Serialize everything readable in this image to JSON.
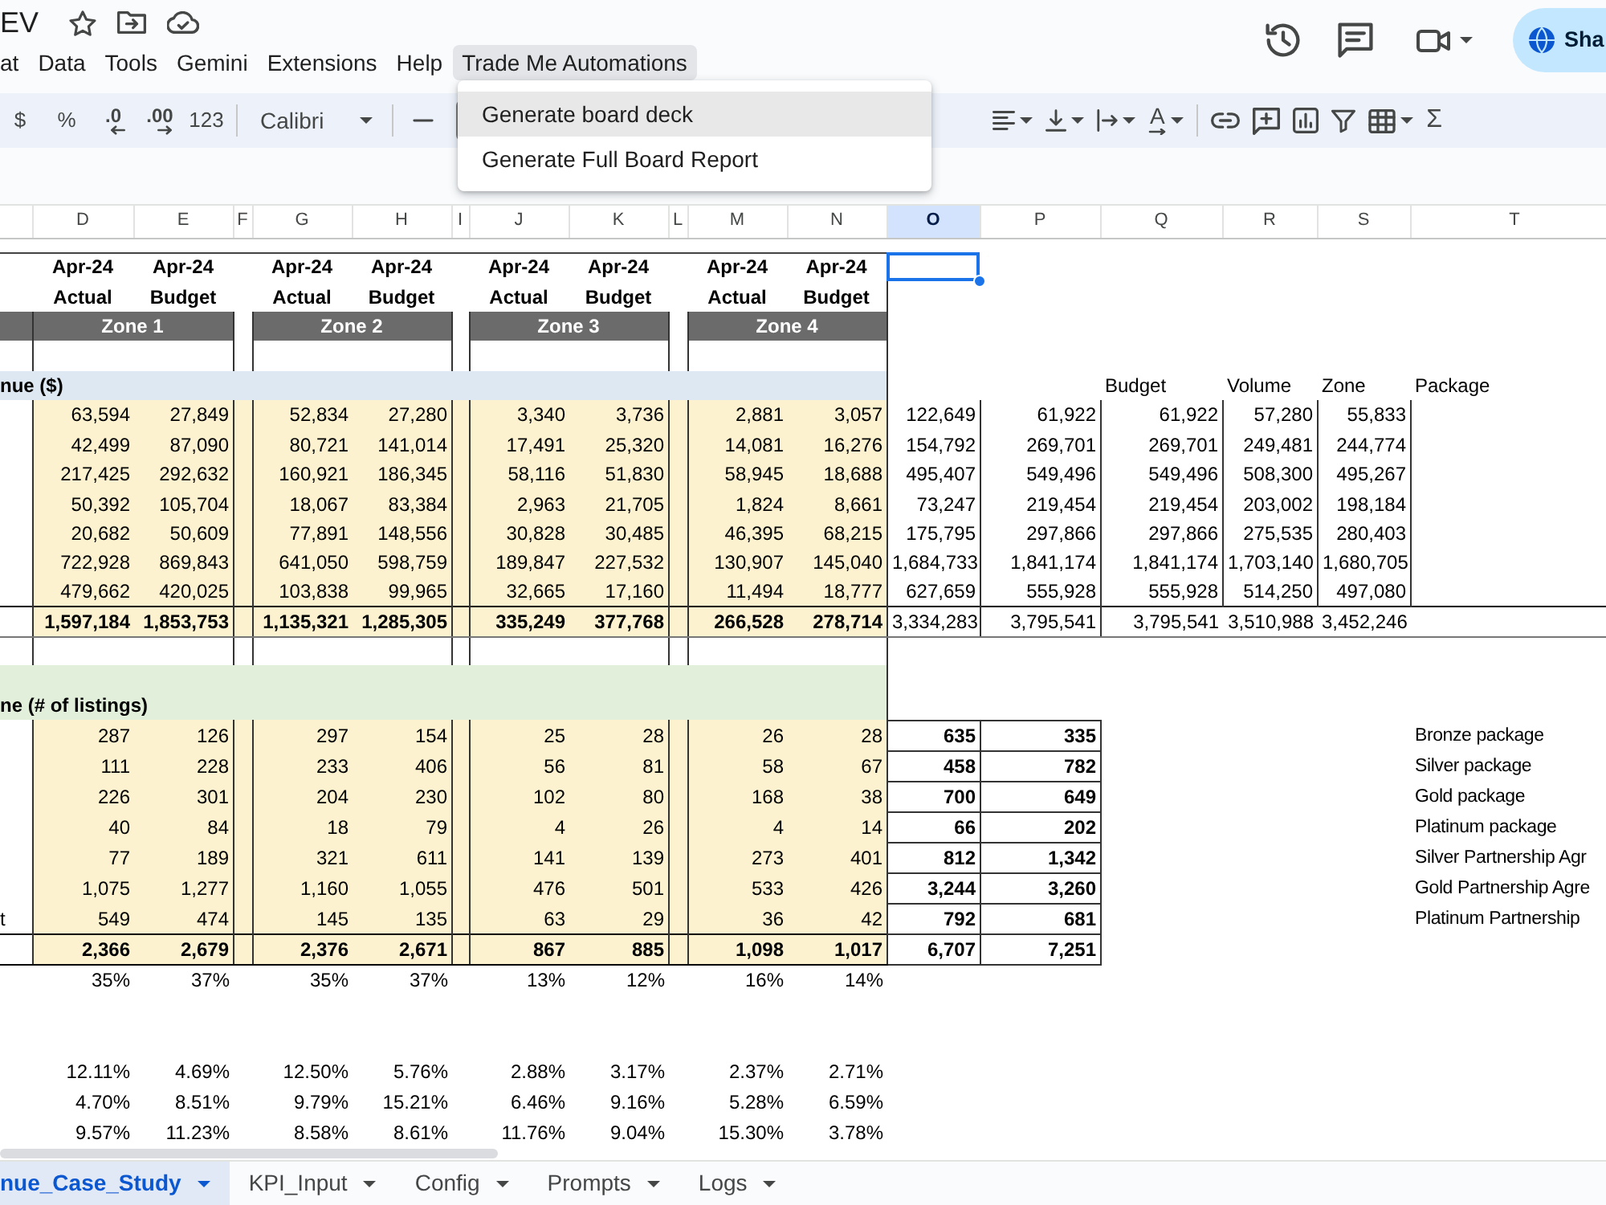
{
  "document": {
    "title": "EV"
  },
  "menu_bar": [
    {
      "label": "at",
      "selected": false
    },
    {
      "label": "Data",
      "selected": false
    },
    {
      "label": "Tools",
      "selected": false
    },
    {
      "label": "Gemini",
      "selected": false
    },
    {
      "label": "Extensions",
      "selected": false
    },
    {
      "label": "Help",
      "selected": false
    },
    {
      "label": "Trade Me Automations",
      "selected": true
    }
  ],
  "open_menu": [
    {
      "label": "Generate board deck",
      "selected": true
    },
    {
      "label": "Generate Full Board Report",
      "selected": false
    }
  ],
  "share_button": {
    "label": "Sha"
  },
  "toolbar_left": [
    {
      "kind": "text",
      "label": "$"
    },
    {
      "kind": "text",
      "label": "%"
    },
    {
      "kind": "decrease-decimal",
      "label": ".0"
    },
    {
      "kind": "increase-decimal",
      "label": ".00"
    },
    {
      "kind": "text",
      "label": "123"
    },
    {
      "kind": "divider"
    },
    {
      "kind": "font",
      "label": "Calibri"
    },
    {
      "kind": "divider"
    },
    {
      "kind": "minus"
    },
    {
      "kind": "size-field"
    }
  ],
  "toolbar_right": [
    {
      "kind": "align"
    },
    {
      "kind": "valign"
    },
    {
      "kind": "wrap"
    },
    {
      "kind": "rotate",
      "label": "A"
    },
    {
      "kind": "divider"
    },
    {
      "kind": "link"
    },
    {
      "kind": "comment"
    },
    {
      "kind": "chart"
    },
    {
      "kind": "filter"
    },
    {
      "kind": "table"
    },
    {
      "kind": "glyph",
      "label": "Σ"
    }
  ],
  "sheet": {
    "column_headers": [
      {
        "label": "D",
        "selected": false
      },
      {
        "label": "E",
        "selected": false
      },
      {
        "label": "F",
        "selected": false
      },
      {
        "label": "G",
        "selected": false
      },
      {
        "label": "H",
        "selected": false
      },
      {
        "label": "I",
        "selected": false
      },
      {
        "label": "J",
        "selected": false
      },
      {
        "label": "K",
        "selected": false
      },
      {
        "label": "L",
        "selected": false
      },
      {
        "label": "M",
        "selected": false
      },
      {
        "label": "N",
        "selected": false
      },
      {
        "label": "O",
        "selected": true
      },
      {
        "label": "P",
        "selected": false
      },
      {
        "label": "Q",
        "selected": false
      },
      {
        "label": "R",
        "selected": false
      },
      {
        "label": "S",
        "selected": false
      },
      {
        "label": "T",
        "selected": false
      }
    ],
    "period_row": [
      "Apr-24",
      "Apr-24",
      "Apr-24",
      "Apr-24",
      "Apr-24",
      "Apr-24",
      "Apr-24",
      "Apr-24"
    ],
    "measure_row": [
      "Actual",
      "Budget",
      "Actual",
      "Budget",
      "Actual",
      "Budget",
      "Actual",
      "Budget"
    ],
    "zones": [
      "Zone 1",
      "Zone 2",
      "Zone 3",
      "Zone 4"
    ],
    "revenue": {
      "label": "nue ($)",
      "side_headers": [
        "Budget",
        "Volume",
        "Zone",
        "Package"
      ],
      "rows": [
        {
          "zone_values": [
            "63,594",
            "27,849",
            "52,834",
            "27,280",
            "3,340",
            "3,736",
            "2,881",
            "3,057"
          ],
          "side_values": [
            "122,649",
            "61,922",
            "61,922",
            "57,280",
            "55,833"
          ]
        },
        {
          "zone_values": [
            "42,499",
            "87,090",
            "80,721",
            "141,014",
            "17,491",
            "25,320",
            "14,081",
            "16,276"
          ],
          "side_values": [
            "154,792",
            "269,701",
            "269,701",
            "249,481",
            "244,774"
          ]
        },
        {
          "zone_values": [
            "217,425",
            "292,632",
            "160,921",
            "186,345",
            "58,116",
            "51,830",
            "58,945",
            "18,688"
          ],
          "side_values": [
            "495,407",
            "549,496",
            "549,496",
            "508,300",
            "495,267"
          ]
        },
        {
          "zone_values": [
            "50,392",
            "105,704",
            "18,067",
            "83,384",
            "2,963",
            "21,705",
            "1,824",
            "8,661"
          ],
          "side_values": [
            "73,247",
            "219,454",
            "219,454",
            "203,002",
            "198,184"
          ]
        },
        {
          "zone_values": [
            "20,682",
            "50,609",
            "77,891",
            "148,556",
            "30,828",
            "30,485",
            "46,395",
            "68,215"
          ],
          "side_values": [
            "175,795",
            "297,866",
            "297,866",
            "275,535",
            "280,403"
          ]
        },
        {
          "zone_values": [
            "722,928",
            "869,843",
            "641,050",
            "598,759",
            "189,847",
            "227,532",
            "130,907",
            "145,040"
          ],
          "side_values": [
            "1,684,733",
            "1,841,174",
            "1,841,174",
            "1,703,140",
            "1,680,705"
          ]
        },
        {
          "zone_values": [
            "479,662",
            "420,025",
            "103,838",
            "99,965",
            "32,665",
            "17,160",
            "11,494",
            "18,777"
          ],
          "side_values": [
            "627,659",
            "555,928",
            "555,928",
            "514,250",
            "497,080"
          ]
        }
      ],
      "total": {
        "zone_values": [
          "1,597,184",
          "1,853,753",
          "1,135,321",
          "1,285,305",
          "335,249",
          "377,768",
          "266,528",
          "278,714"
        ],
        "side_values": [
          "3,334,283",
          "3,795,541",
          "3,795,541",
          "3,510,988",
          "3,452,246"
        ]
      }
    },
    "volume": {
      "label": "ne (# of listings)",
      "rows": [
        {
          "zone_values": [
            "287",
            "126",
            "297",
            "154",
            "25",
            "28",
            "26",
            "28"
          ],
          "side_values": [
            "635",
            "335"
          ],
          "package": "Bronze package"
        },
        {
          "zone_values": [
            "111",
            "228",
            "233",
            "406",
            "56",
            "81",
            "58",
            "67"
          ],
          "side_values": [
            "458",
            "782"
          ],
          "package": "Silver package"
        },
        {
          "zone_values": [
            "226",
            "301",
            "204",
            "230",
            "102",
            "80",
            "168",
            "38"
          ],
          "side_values": [
            "700",
            "649"
          ],
          "package": "Gold package"
        },
        {
          "zone_values": [
            "40",
            "84",
            "18",
            "79",
            "4",
            "26",
            "4",
            "14"
          ],
          "side_values": [
            "66",
            "202"
          ],
          "package": "Platinum package"
        },
        {
          "zone_values": [
            "77",
            "189",
            "321",
            "611",
            "141",
            "139",
            "273",
            "401"
          ],
          "side_values": [
            "812",
            "1,342"
          ],
          "package": "Silver Partnership Agr"
        },
        {
          "zone_values": [
            "1,075",
            "1,277",
            "1,160",
            "1,055",
            "476",
            "501",
            "533",
            "426"
          ],
          "side_values": [
            "3,244",
            "3,260"
          ],
          "package": "Gold Partnership Agre"
        },
        {
          "label": "t",
          "zone_values": [
            "549",
            "474",
            "145",
            "135",
            "63",
            "29",
            "36",
            "42"
          ],
          "side_values": [
            "792",
            "681"
          ],
          "package": "Platinum Partnership"
        }
      ],
      "total": {
        "zone_values": [
          "2,366",
          "2,679",
          "2,376",
          "2,671",
          "867",
          "885",
          "1,098",
          "1,017"
        ],
        "side_values": [
          "6,707",
          "7,251"
        ]
      },
      "share": [
        "35%",
        "37%",
        "35%",
        "37%",
        "13%",
        "12%",
        "16%",
        "14%"
      ]
    },
    "ratios": [
      [
        "12.11%",
        "4.69%",
        "12.50%",
        "5.76%",
        "2.88%",
        "3.17%",
        "2.37%",
        "2.71%"
      ],
      [
        "4.70%",
        "8.51%",
        "9.79%",
        "15.21%",
        "6.46%",
        "9.16%",
        "5.28%",
        "6.59%"
      ],
      [
        "9.57%",
        "11.23%",
        "8.58%",
        "8.61%",
        "11.76%",
        "9.04%",
        "15.30%",
        "3.78%"
      ]
    ]
  },
  "sheet_tabs": [
    {
      "label": "nue_Case_Study",
      "selected": true
    },
    {
      "label": "KPI_Input",
      "selected": false
    },
    {
      "label": "Config",
      "selected": false
    },
    {
      "label": "Prompts",
      "selected": false
    },
    {
      "label": "Logs",
      "selected": false
    }
  ]
}
